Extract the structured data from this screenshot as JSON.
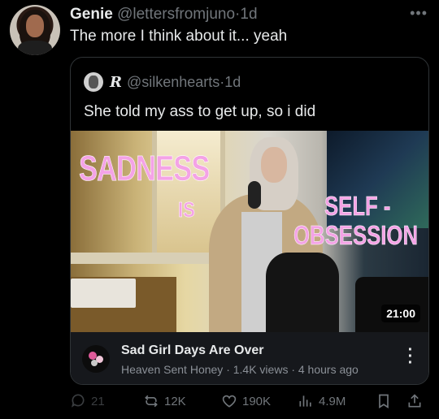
{
  "tweet": {
    "author_name": "Genie",
    "author_handle": "@lettersfromjuno",
    "separator": "·",
    "time": "1d",
    "text": "The more I think about it... yeah"
  },
  "quoted": {
    "author_name": "R",
    "author_handle": "@silkenhearts",
    "separator": "·",
    "time": "1d",
    "text": "She told my ass to get up, so i did"
  },
  "video": {
    "overlay_line1": "SADNESS",
    "overlay_line2": "IS",
    "overlay_line3": "SELF -",
    "overlay_line4": "OBSESSION",
    "duration": "21:00"
  },
  "youtube_card": {
    "title": "Sad Girl Days Are Over",
    "meta": "Heaven Sent Honey · 1.4K views · 4 hours ago"
  },
  "actions": {
    "replies": "21",
    "retweets": "12K",
    "likes": "190K",
    "views": "4.9M"
  },
  "colors": {
    "background": "#000000",
    "text": "#e7e9ea",
    "muted": "#71767b",
    "overlay_pink": "#f4a3e6",
    "card_border": "#2f3336"
  }
}
